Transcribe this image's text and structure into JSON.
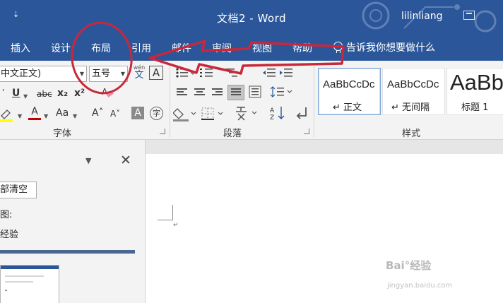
{
  "titlebar": {
    "qa_glyph": "⇣",
    "doc_title": "文档2  -  Word",
    "user": "lilinliang",
    "restore_icon": "ribbon-display-icon"
  },
  "tabs": [
    {
      "label": "插入"
    },
    {
      "label": "设计"
    },
    {
      "label": "布局"
    },
    {
      "label": "引用"
    },
    {
      "label": "邮件"
    },
    {
      "label": "审阅"
    },
    {
      "label": "视图"
    },
    {
      "label": "帮助"
    }
  ],
  "tell_me": "告诉我你想要做什么",
  "font_group": {
    "font_name": "中文正文)",
    "font_size": "五号",
    "phonetic_top": "wén",
    "phonetic_bottom": "文",
    "char_border": "A",
    "underline": "U",
    "strike": "abc",
    "subscript": "x₂",
    "superscript": "x²",
    "change_case": "Aa",
    "grow": "A˄",
    "shrink": "A˅",
    "shading": "A",
    "enclose": "字",
    "font_color": "A",
    "label": "字体"
  },
  "paragraph_group": {
    "label": "段落"
  },
  "styles_group": {
    "styles": [
      {
        "sample": "AaBbCcDc",
        "name": "↵ 正文"
      },
      {
        "sample": "AaBbCcDc",
        "name": "↵ 无间隔"
      },
      {
        "sample": "AaBb",
        "name": "标题 1"
      }
    ],
    "label": "样式"
  },
  "nav_pane": {
    "clear_button": "部清空",
    "line1": "图:",
    "line2": "经验"
  },
  "document": {
    "para_mark": "↵"
  },
  "watermark": {
    "brand": "Bai°经验",
    "url": "jingyan.baidu.com"
  },
  "colors": {
    "accent": "#2b579a",
    "highlight": "#ffff00",
    "font_color": "#c00000",
    "annotation": "#c8283a"
  }
}
